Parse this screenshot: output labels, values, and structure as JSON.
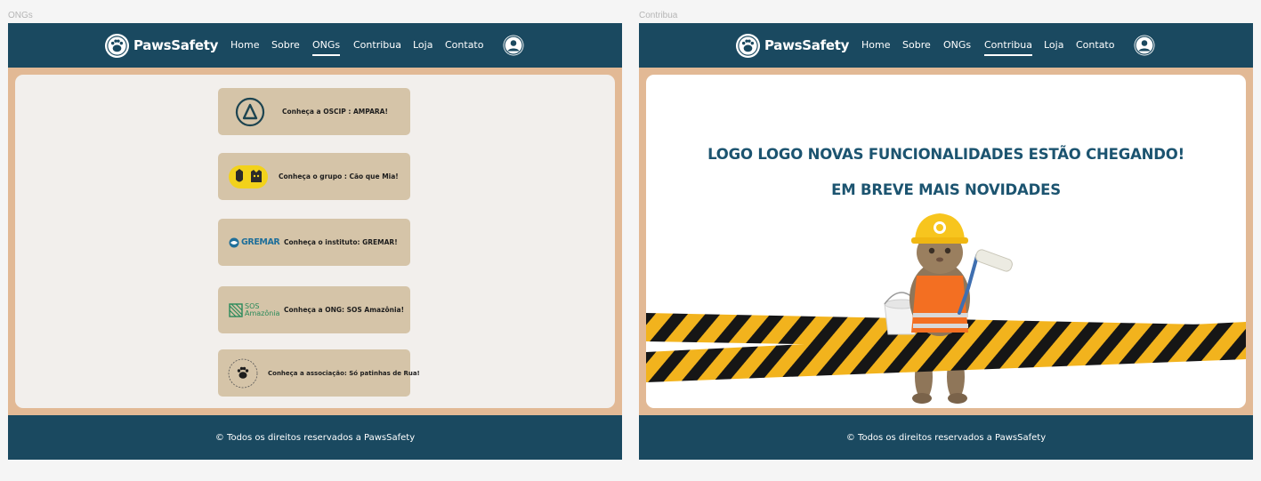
{
  "frames": [
    {
      "label": "ONGs",
      "brand": "PawsSafety",
      "nav": [
        "Home",
        "Sobre",
        "ONGs",
        "Contribua",
        "Loja",
        "Contato"
      ],
      "active_nav": "ONGs",
      "ongs": [
        {
          "text": "Conheça a OSCIP : AMPARA!",
          "logo": "ampara-logo"
        },
        {
          "text": "Conheça o grupo : Cão que Mia!",
          "logo": "cao-que-mia-logo"
        },
        {
          "text": "Conheça o instituto: GREMAR!",
          "logo": "gremar-logo",
          "logo_text": "GREMAR"
        },
        {
          "text": "Conheça a ONG: SOS Amazônia!",
          "logo": "sos-amazonia-logo",
          "logo_text_1": "SOS",
          "logo_text_2": "Amazônia"
        },
        {
          "text": "Conheça a associação: Só patinhas de Rua!",
          "logo": "so-patinhas-de-rua-logo"
        }
      ],
      "footer": "© Todos os direitos reservados a PawsSafety"
    },
    {
      "label": "Contribua",
      "brand": "PawsSafety",
      "nav": [
        "Home",
        "Sobre",
        "ONGs",
        "Contribua",
        "Loja",
        "Contato"
      ],
      "active_nav": "Contribua",
      "headline_1": "LOGO LOGO NOVAS FUNCIONALIDADES ESTÃO CHEGANDO!",
      "headline_2": "EM BREVE MAIS NOVIDADES",
      "illustration": "construction-cat-with-caution-tape",
      "footer": "© Todos os direitos reservados a PawsSafety"
    }
  ],
  "colors": {
    "navbar": "#1a4960",
    "page_frame": "#e2b995",
    "ong_card": "#d5c4a8",
    "headline": "#1c5470"
  }
}
